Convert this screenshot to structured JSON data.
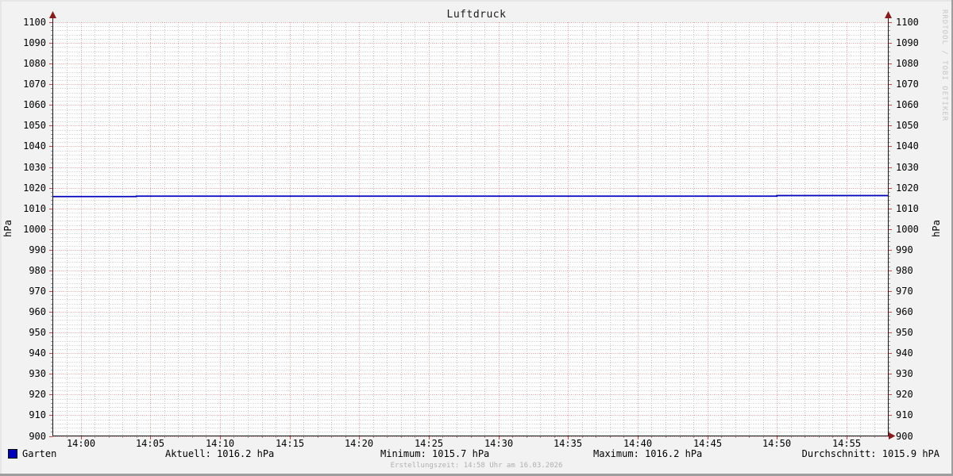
{
  "title": "Luftdruck",
  "watermark": "RRDTOOL / TOBI OETIKER",
  "y_axis_unit_left": "hPa",
  "y_axis_unit_right": "hPa",
  "footer": "Erstellungszeit: 14:58 Uhr am 16.03.2026",
  "legend": {
    "series_label": "Garten",
    "series_color": "#0000c0",
    "aktuell": "Aktuell: 1016.2 hPa",
    "minimum": "Minimum: 1015.7 hPa",
    "maximum": "Maximum: 1016.2 hPa",
    "durchschnitt": "Durchschnitt: 1015.9 hPA"
  },
  "colors": {
    "background": "#f2f2f2",
    "canvas": "#ffffff",
    "major_grid": "#cc4444",
    "minor_grid": "#bbbbbb",
    "axis": "#1a1a1a",
    "arrow": "#8b1a1a",
    "muted_text": "#b0b0b0",
    "watermark_text": "#c6c6c6"
  },
  "chart_data": {
    "type": "line",
    "title": "Luftdruck",
    "ylabel": "hPa",
    "ylim": [
      900,
      1100
    ],
    "y_major_step": 10,
    "y_minor_step": 2,
    "y_tick_labels": [
      900,
      910,
      920,
      930,
      940,
      950,
      960,
      970,
      980,
      990,
      1000,
      1010,
      1020,
      1030,
      1040,
      1050,
      1060,
      1070,
      1080,
      1090,
      1100
    ],
    "x_start": "13:58",
    "x_end": "14:58",
    "x_minor_step_minutes": 1,
    "x_major_step_minutes": 5,
    "x_tick_labels": [
      "14:00",
      "14:05",
      "14:10",
      "14:15",
      "14:20",
      "14:25",
      "14:30",
      "14:35",
      "14:40",
      "14:45",
      "14:50",
      "14:55"
    ],
    "grid": true,
    "legend_position": "bottom",
    "series": [
      {
        "name": "Garten",
        "color": "#0000c0",
        "line_style": "step",
        "points": [
          [
            "13:58",
            1015.7
          ],
          [
            "14:04",
            1015.9
          ],
          [
            "14:50",
            1016.2
          ],
          [
            "14:58",
            1016.2
          ]
        ],
        "stats": {
          "current": 1016.2,
          "min": 1015.7,
          "max": 1016.2,
          "avg": 1015.9,
          "unit": "hPa"
        }
      }
    ]
  }
}
